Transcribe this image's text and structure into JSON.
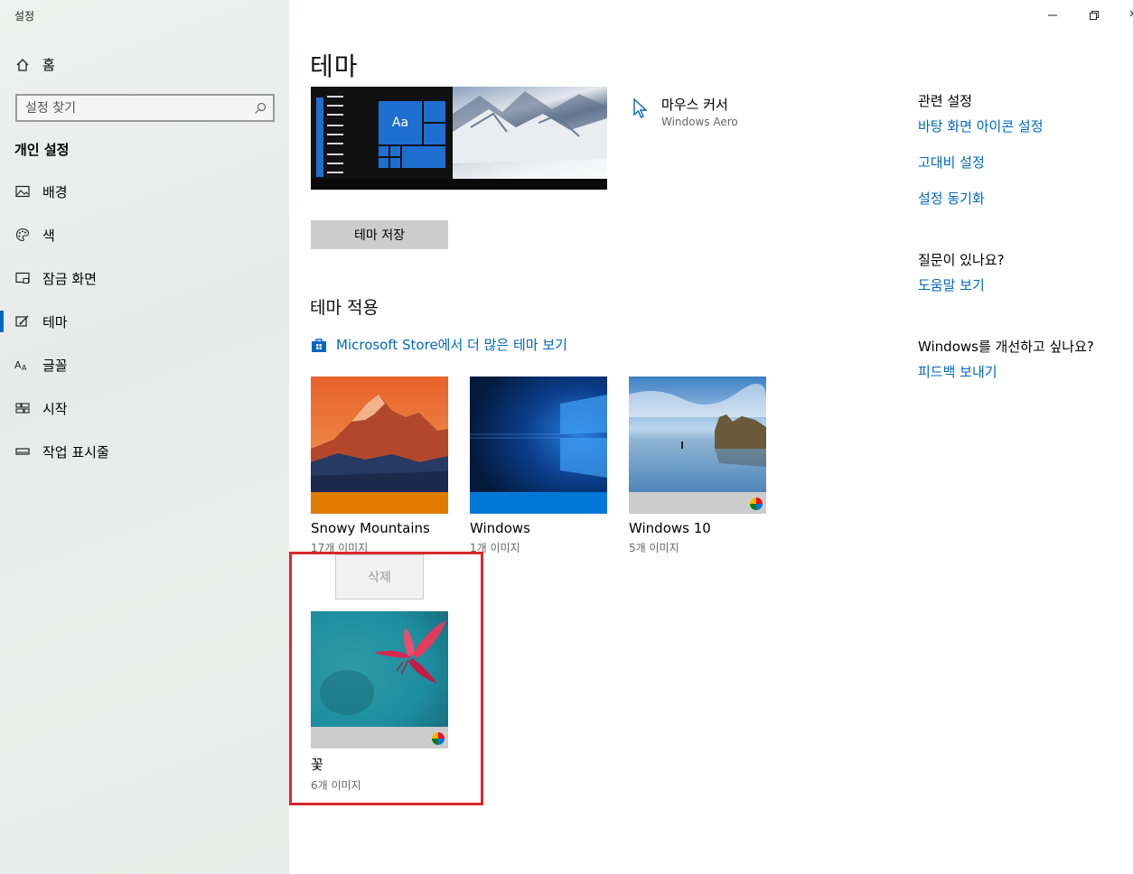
{
  "app": {
    "title": "설정"
  },
  "sidebar": {
    "home_label": "홈",
    "search_placeholder": "설정 찾기",
    "section": "개인 설정",
    "items": [
      {
        "label": "배경",
        "icon": "picture-icon"
      },
      {
        "label": "색",
        "icon": "palette-icon"
      },
      {
        "label": "잠금 화면",
        "icon": "lock-screen-icon"
      },
      {
        "label": "테마",
        "icon": "theme-icon",
        "active": true
      },
      {
        "label": "글꼴",
        "icon": "font-icon"
      },
      {
        "label": "시작",
        "icon": "start-icon"
      },
      {
        "label": "작업 표시줄",
        "icon": "taskbar-icon"
      }
    ]
  },
  "main": {
    "title": "테마",
    "preview_tile_text": "Aa",
    "save_button": "테마 저장",
    "cursor": {
      "title": "마우스 커서",
      "value": "Windows Aero"
    },
    "apply_heading": "테마 적용",
    "store_link": "Microsoft Store에서 더 많은 테마 보기",
    "themes": [
      {
        "name": "Snowy Mountains",
        "count": "17개 이미지",
        "accent": "#e07b00"
      },
      {
        "name": "Windows",
        "count": "1개 이미지",
        "accent": "#0078d7"
      },
      {
        "name": "Windows 10",
        "count": "5개 이미지",
        "accent": "#cccccc"
      },
      {
        "name": "꽃",
        "count": "6개 이미지",
        "accent": "#cccccc"
      }
    ],
    "context_menu": {
      "delete": "삭제"
    }
  },
  "related": {
    "heading": "관련 설정",
    "links": [
      "바탕 화면 아이콘 설정",
      "고대비 설정",
      "설정 동기화"
    ],
    "help_heading": "질문이 있나요?",
    "help_link": "도움말 보기",
    "feedback_heading": "Windows를 개선하고 싶나요?",
    "feedback_link": "피드백 보내기"
  },
  "colors": {
    "accent": "#0067c0",
    "highlight": "#d7282c"
  }
}
